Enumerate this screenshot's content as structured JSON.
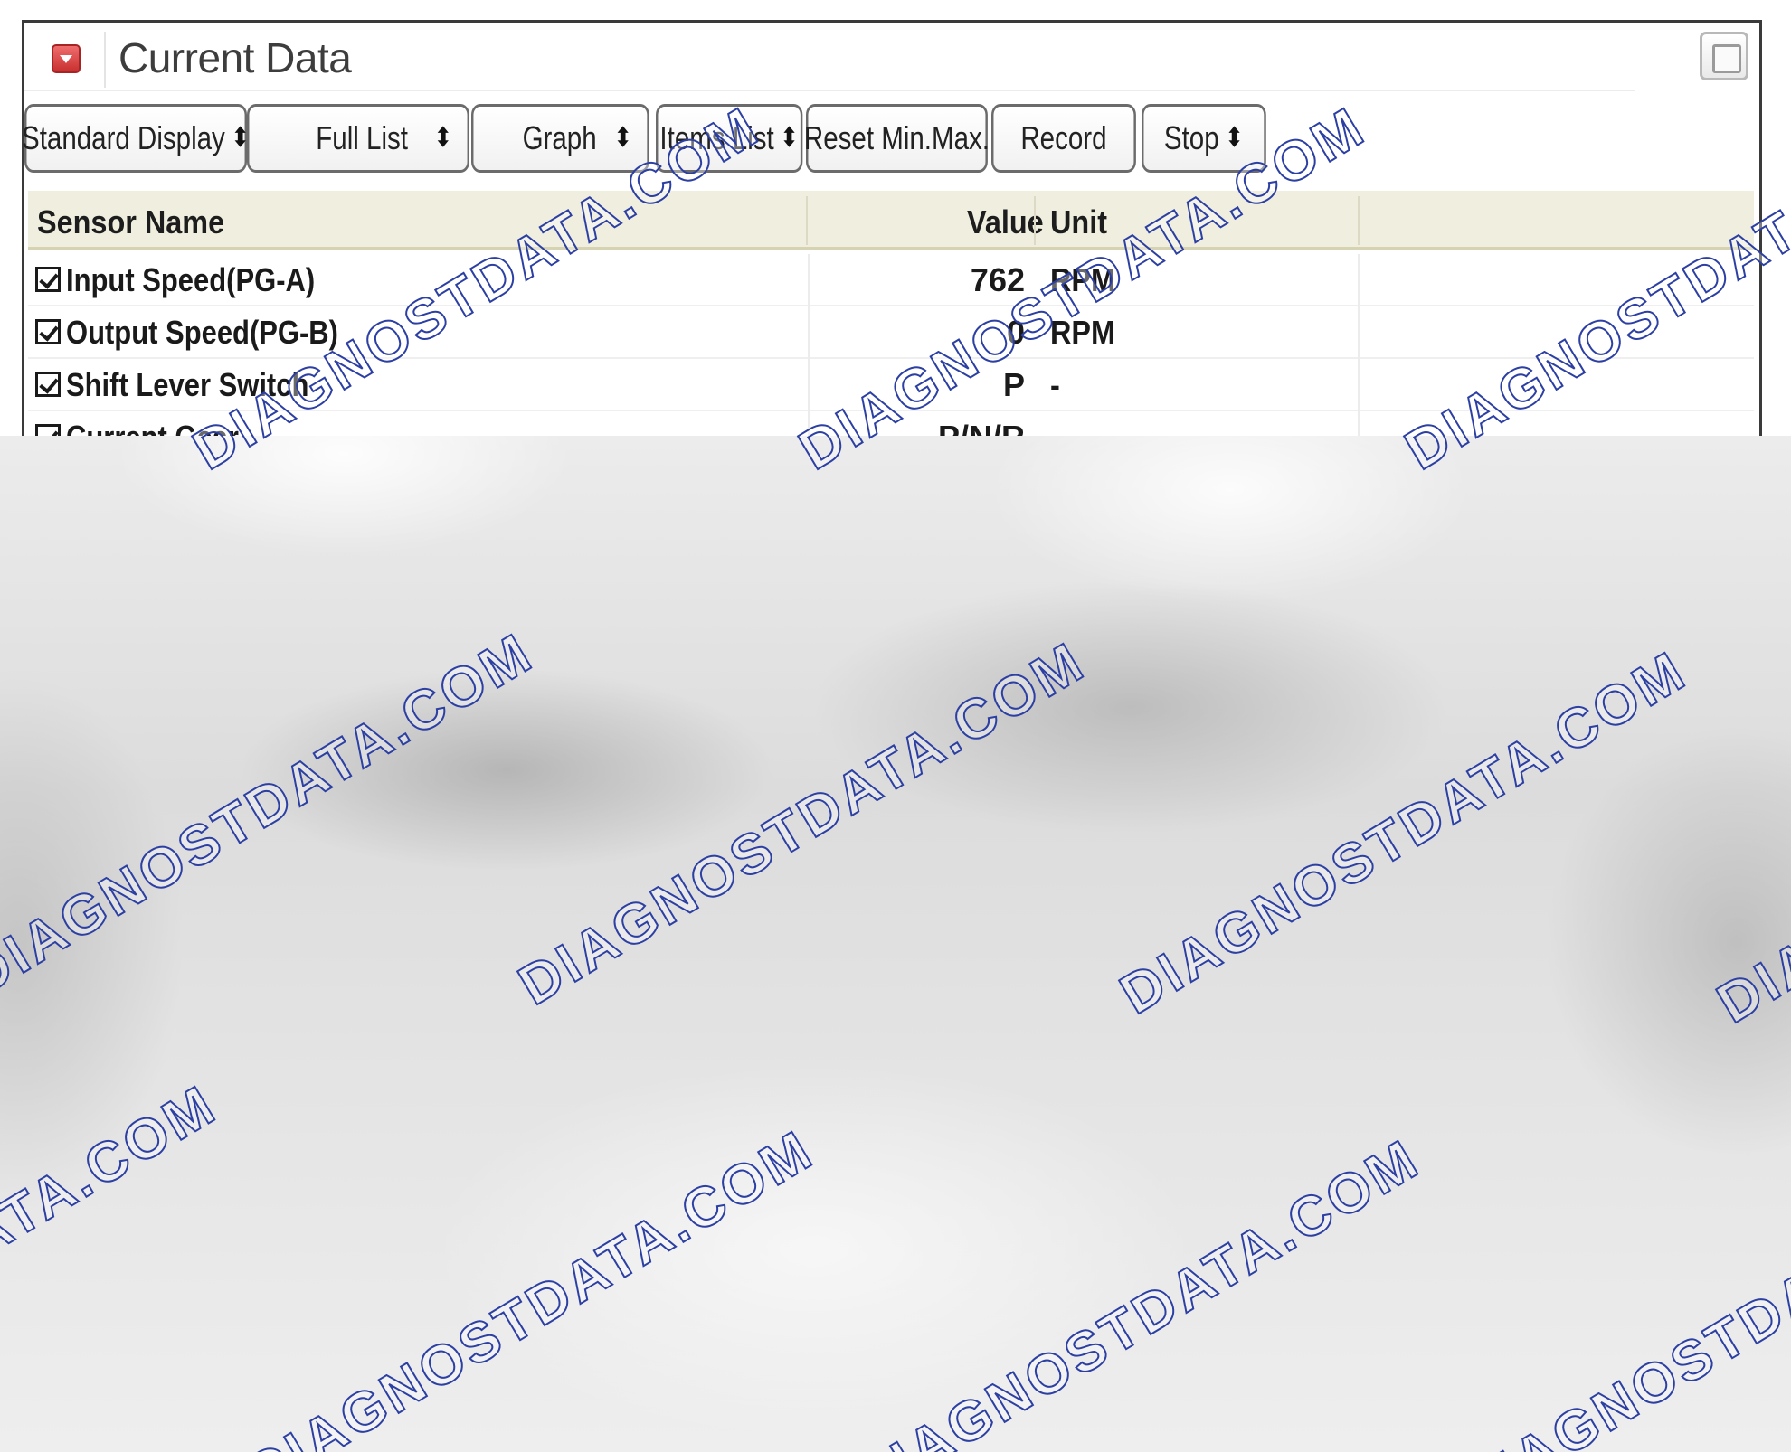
{
  "window": {
    "title": "Current Data"
  },
  "toolbar": [
    {
      "label": "Standard Display",
      "dropdown": true
    },
    {
      "label": "Full List",
      "dropdown": true
    },
    {
      "label": "Graph",
      "dropdown": true
    },
    {
      "label": "Items List",
      "dropdown": true
    },
    {
      "label": "Reset Min.Max.",
      "dropdown": false
    },
    {
      "label": "Record",
      "dropdown": false
    },
    {
      "label": "Stop",
      "dropdown": true
    }
  ],
  "table": {
    "headers": {
      "sensor_name": "Sensor Name",
      "value": "Value",
      "unit": "Unit"
    },
    "rows": [
      {
        "checked": true,
        "name": "Input Speed(PG-A)",
        "value": "762",
        "unit": "RPM"
      },
      {
        "checked": true,
        "name": "Output Speed(PG-B)",
        "value": "0",
        "unit": "RPM"
      },
      {
        "checked": true,
        "name": "Shift Lever Switch",
        "value": "P",
        "unit": "-"
      },
      {
        "checked": true,
        "name": "Current Gear",
        "value": "P/N/R",
        "unit": "-"
      }
    ]
  },
  "watermark": {
    "text": "DIAGNOSTDATA.COM",
    "color": "#2c3fa3"
  }
}
